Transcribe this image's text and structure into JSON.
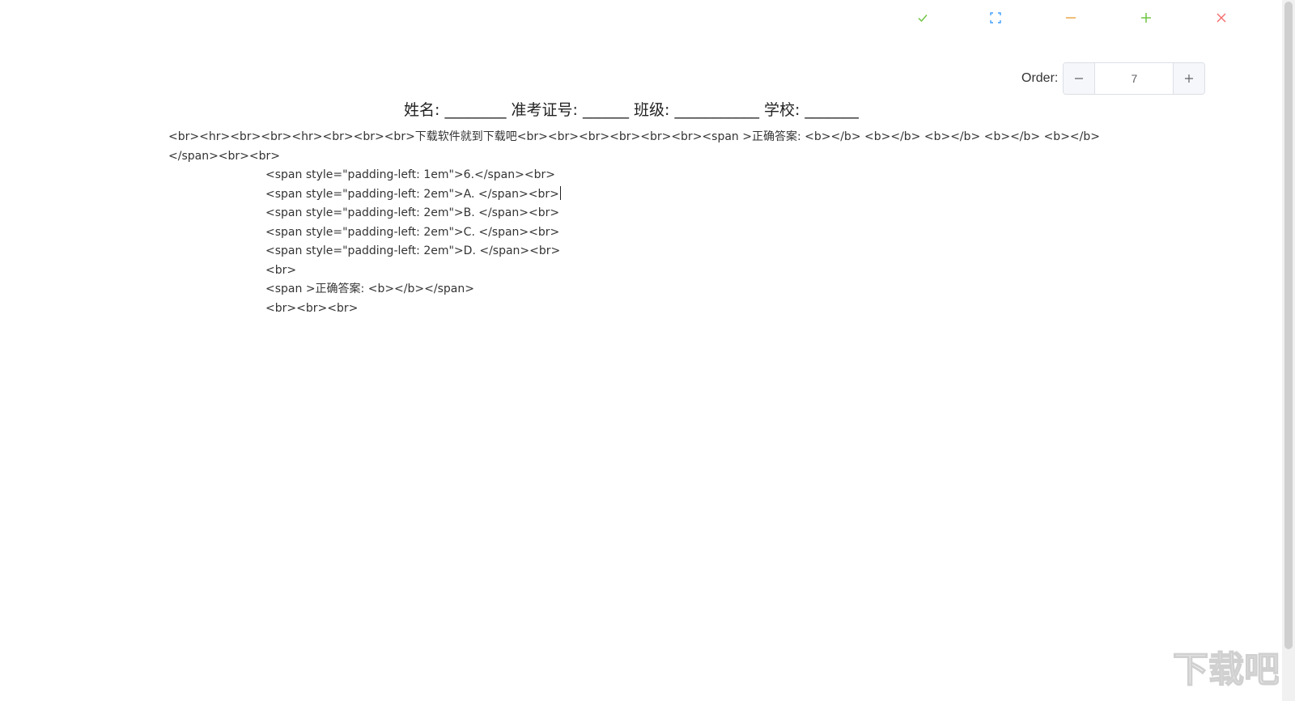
{
  "toolbar": {
    "icons": [
      "check-icon",
      "fullscreen-icon",
      "minimize-icon",
      "add-icon",
      "close-icon"
    ],
    "colors": {
      "check": "#67c23a",
      "fullscreen": "#409eff",
      "minimize": "#e6a23c",
      "add": "#67c23a",
      "close": "#f56c6c"
    }
  },
  "order": {
    "label": "Order:",
    "value": "7",
    "minus": "−",
    "plus": "+"
  },
  "header": {
    "text": "姓名: ________ 准考证号: ______ 班级: ___________ 学校: _______"
  },
  "editor": {
    "lines": [
      "<br><hr><br><br><hr><br><br><br>下载软件就到下载吧<br><br><br><br><br><br><span >正确答案: <b></b> <b></b> <b></b> <b></b> <b></b>",
      "</span><br><br>",
      "<span style=\"padding-left: 1em\">6.</span><br>",
      "<span style=\"padding-left: 2em\">A. </span><br>",
      "<span style=\"padding-left: 2em\">B. </span><br>",
      "<span style=\"padding-left: 2em\">C. </span><br>",
      "<span style=\"padding-left: 2em\">D. </span><br>",
      "<br>",
      "<span >正确答案: <b></b></span>",
      "<br><br><br>"
    ]
  },
  "watermark": {
    "text": "下载吧"
  }
}
